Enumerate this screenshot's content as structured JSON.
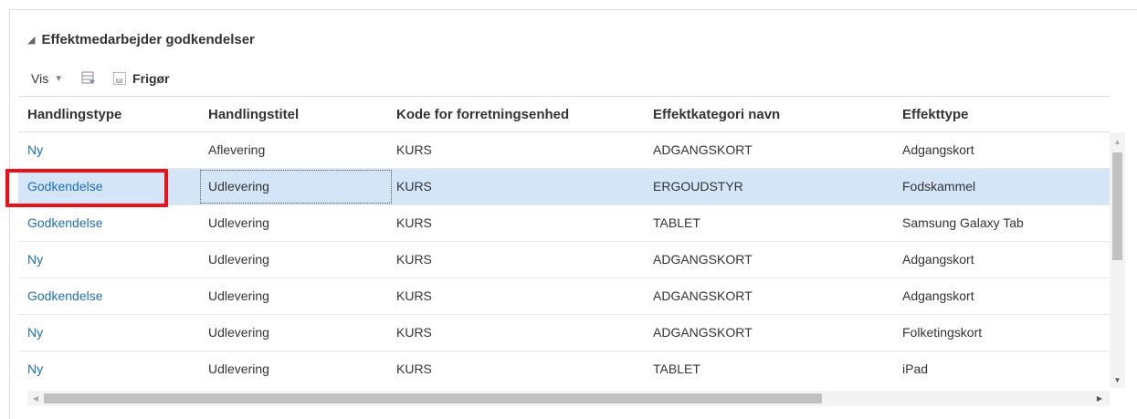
{
  "panel": {
    "title": "Effektmedarbejder godkendelser"
  },
  "toolbar": {
    "view_label": "Vis",
    "detach_label": "Frigør"
  },
  "table": {
    "columns": [
      "Handlingstype",
      "Handlingstitel",
      "Kode for forretningsenhed",
      "Effektkategori navn",
      "Effekttype"
    ],
    "rows": [
      {
        "handlingstype": "Ny",
        "handlingstitel": "Aflevering",
        "kode": "KURS",
        "kategori": "ADGANGSKORT",
        "type": "Adgangskort"
      },
      {
        "handlingstype": "Godkendelse",
        "handlingstitel": "Udlevering",
        "kode": "KURS",
        "kategori": "ERGOUDSTYR",
        "type": "Fodskammel"
      },
      {
        "handlingstype": "Godkendelse",
        "handlingstitel": "Udlevering",
        "kode": "KURS",
        "kategori": "TABLET",
        "type": "Samsung Galaxy Tab"
      },
      {
        "handlingstype": "Ny",
        "handlingstitel": "Udlevering",
        "kode": "KURS",
        "kategori": "ADGANGSKORT",
        "type": "Adgangskort"
      },
      {
        "handlingstype": "Godkendelse",
        "handlingstitel": "Udlevering",
        "kode": "KURS",
        "kategori": "ADGANGSKORT",
        "type": "Adgangskort"
      },
      {
        "handlingstype": "Ny",
        "handlingstitel": "Udlevering",
        "kode": "KURS",
        "kategori": "ADGANGSKORT",
        "type": "Folketingskort"
      },
      {
        "handlingstype": "Ny",
        "handlingstitel": "Udlevering",
        "kode": "KURS",
        "kategori": "TABLET",
        "type": "iPad"
      }
    ],
    "selected_row": 1
  },
  "colors": {
    "link": "#1f6fb5",
    "selected_row": "#d3e5f7",
    "highlight": "#e8131a"
  },
  "icons": {
    "collapse": "triangle-down-icon",
    "view_menu": "chevron-down-icon",
    "detach_table": "detach-table-icon",
    "freeze": "freeze-icon"
  }
}
